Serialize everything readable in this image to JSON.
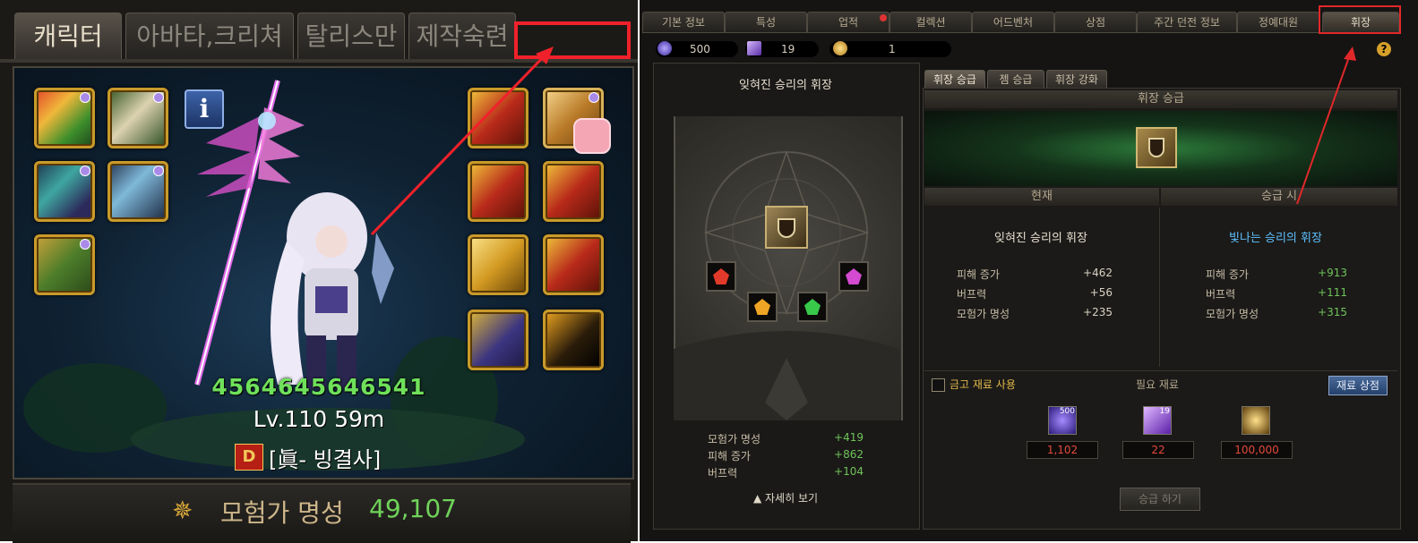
{
  "left": {
    "tabs": [
      {
        "label": "캐릭터",
        "active": true
      },
      {
        "label": "아바타,크리쳐",
        "active": false
      },
      {
        "label": "탈리스만",
        "active": false
      },
      {
        "label": "제작숙련",
        "active": false
      }
    ],
    "info_icon": "i",
    "character": {
      "name": "4564645646541",
      "level": "Lv.110 59m",
      "guild_badge": "D",
      "guild": "[眞- 빙결사]"
    },
    "equipment_left": [
      "weapon-slot",
      "top-slot",
      "shoulder-slot",
      "belt-slot",
      "boots-slot"
    ],
    "equipment_right": [
      "title-slot",
      "pet-slot",
      "bracelet-slot",
      "necklace-slot",
      "support-slot",
      "ring-slot",
      "earring-slot",
      "magic-stone-slot"
    ],
    "fame": {
      "label": "모험가 명성",
      "value": "49,107"
    },
    "highlight_color": "#f0212a"
  },
  "right": {
    "tabs": [
      {
        "label": "기본 정보",
        "active": false
      },
      {
        "label": "특성",
        "active": false
      },
      {
        "label": "업적",
        "active": false
      },
      {
        "label": "컬렉션",
        "active": false
      },
      {
        "label": "어드벤처",
        "active": false
      },
      {
        "label": "상점",
        "active": false
      },
      {
        "label": "주간 던전 정보",
        "active": false
      },
      {
        "label": "정예대원",
        "active": false
      },
      {
        "label": "휘장",
        "active": true
      }
    ],
    "currencies": [
      {
        "icon": "purple-orb-icon",
        "value": "500"
      },
      {
        "icon": "purple-cube-icon",
        "value": "19"
      },
      {
        "icon": "gold-coins-icon",
        "value": "1"
      }
    ],
    "help": "?",
    "banner": {
      "title": "잊혀진 승리의 휘장",
      "stats": [
        {
          "name": "모험가 명성",
          "value": "+419"
        },
        {
          "name": "피해 증가",
          "value": "+862"
        },
        {
          "name": "버프력",
          "value": "+104"
        }
      ],
      "detail_label": "▲ 자세히 보기"
    },
    "subtabs": [
      {
        "label": "휘장 승급",
        "active": true
      },
      {
        "label": "젬 승급",
        "active": false
      },
      {
        "label": "휘장 강화",
        "active": false
      }
    ],
    "upgrade_header": "휘장 승급",
    "current": {
      "header": "현재",
      "name": "잊혀진 승리의 휘장",
      "stats": [
        {
          "name": "피해 증가",
          "value": "+462"
        },
        {
          "name": "버프력",
          "value": "+56"
        },
        {
          "name": "모험가 명성",
          "value": "+235"
        }
      ]
    },
    "after": {
      "header": "승급 시",
      "name": "빛나는 승리의 휘장",
      "stats": [
        {
          "name": "피해 증가",
          "value": "+913"
        },
        {
          "name": "버프력",
          "value": "+111"
        },
        {
          "name": "모험가 명성",
          "value": "+315"
        }
      ]
    },
    "materials": {
      "use_vault_label": "금고 재료 사용",
      "header": "필요 재료",
      "shop_label": "재료 상점",
      "items": [
        {
          "icon": "purple-orb-icon",
          "badge": "500",
          "required": "1,102"
        },
        {
          "icon": "purple-cube-icon",
          "badge": "19",
          "required": "22"
        },
        {
          "icon": "gold-coins-icon",
          "badge": "",
          "required": "100,000"
        }
      ]
    },
    "upgrade_button": "승급 하기",
    "highlight_color": "#e0282a"
  }
}
